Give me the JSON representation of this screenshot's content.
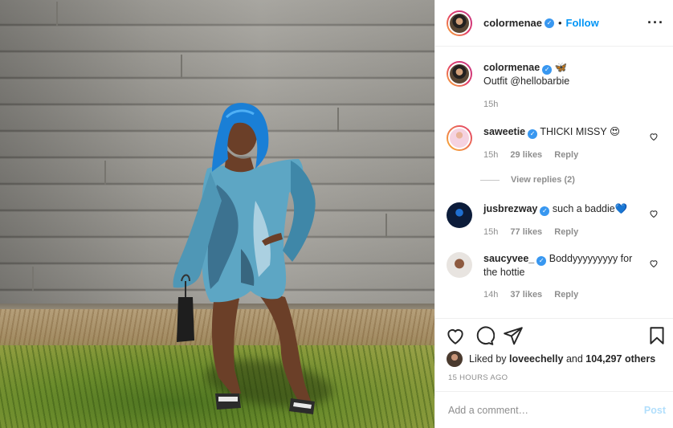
{
  "header": {
    "username": "colormenae",
    "separator": "•",
    "follow_label": "Follow",
    "more_label": "···"
  },
  "caption": {
    "username": "colormenae",
    "emoji": "🦋",
    "text": "Outfit @hellobarbie",
    "time": "15h"
  },
  "comments": [
    {
      "username": "saweetie",
      "verified": true,
      "text": "THICKI MISSY 😍",
      "time": "15h",
      "likes": "29 likes",
      "reply": "Reply"
    },
    {
      "username": "jusbrezway",
      "verified": true,
      "text": "such a baddie💙",
      "time": "15h",
      "likes": "77 likes",
      "reply": "Reply"
    },
    {
      "username": "saucyvee_",
      "verified": true,
      "text": "Boddyyyyyyyyy for the hottie",
      "time": "14h",
      "likes": "37 likes",
      "reply": "Reply"
    }
  ],
  "view_replies": "View replies (2)",
  "actions": {
    "like_icon": "heart-icon",
    "comment_icon": "comment-icon",
    "share_icon": "share-icon",
    "save_icon": "bookmark-icon"
  },
  "likes": {
    "prefix": "Liked by",
    "user": "loveechelly",
    "middle": "and",
    "count": "104,297 others"
  },
  "timestamp": "15 HOURS AGO",
  "add_comment": {
    "placeholder": "Add a comment…",
    "post_label": "Post"
  },
  "colors": {
    "accent": "#0095f6",
    "verified": "#3897f0",
    "muted": "#8e8e8e",
    "post_disabled": "#b2dffc"
  }
}
